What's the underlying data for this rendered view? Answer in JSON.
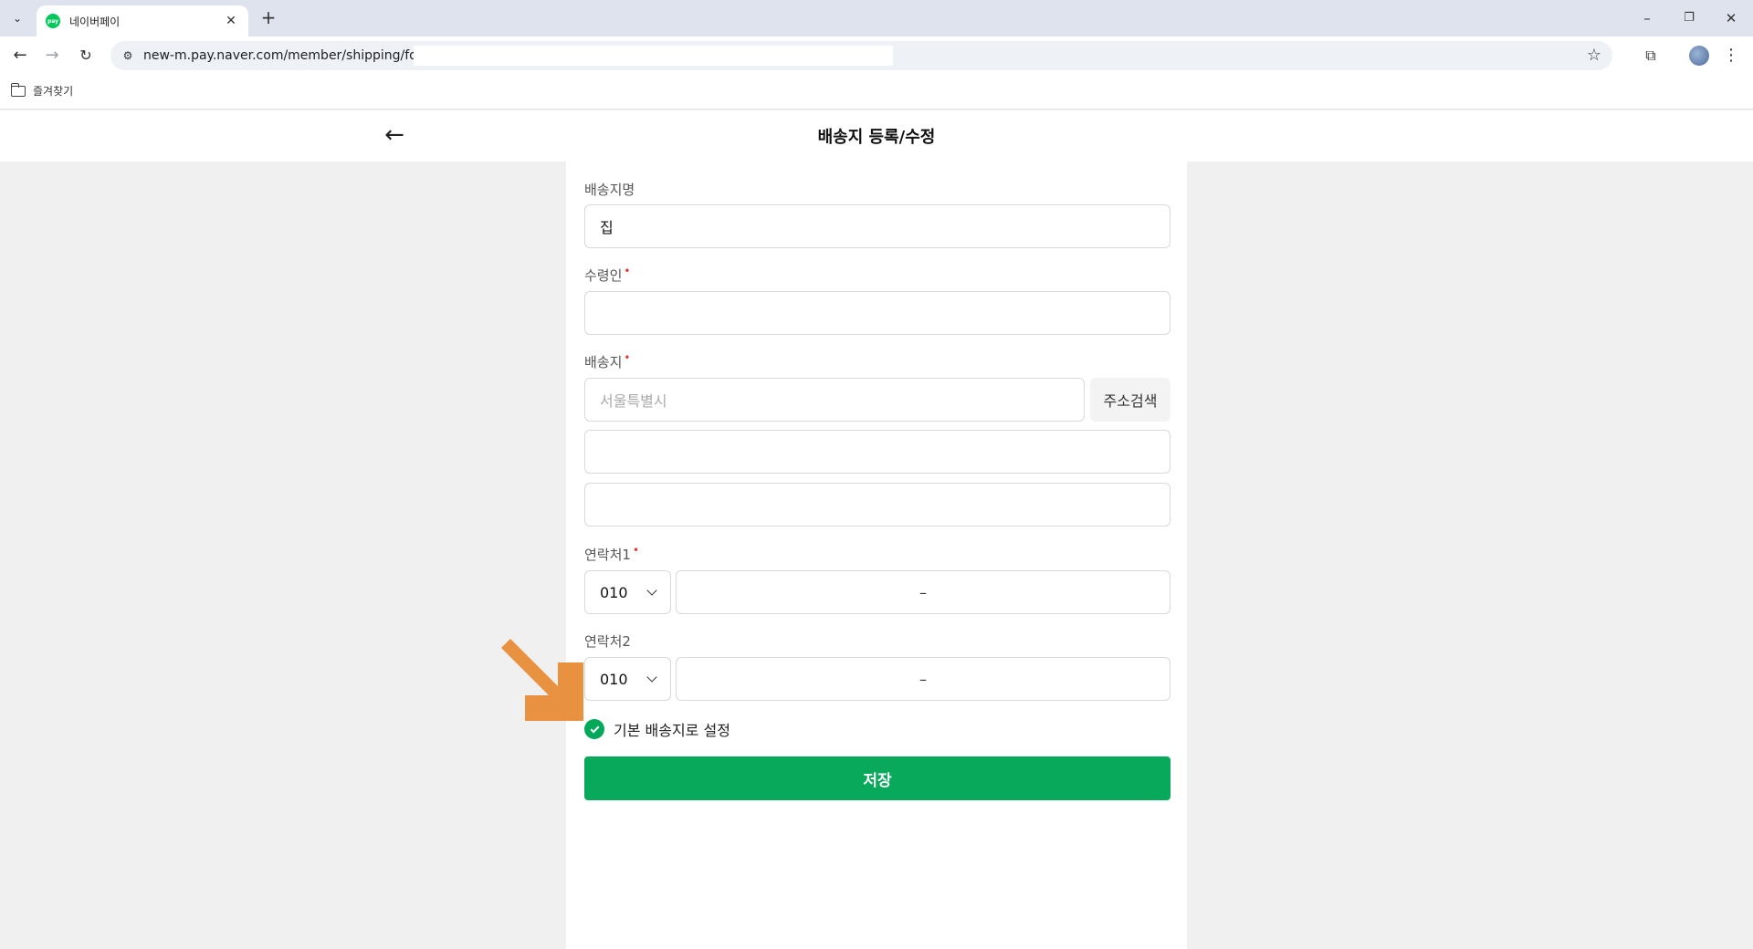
{
  "browser": {
    "tab_title": "네이버페이",
    "favicon_text": "pay",
    "url": "new-m.pay.naver.com/member/shipping/form?",
    "bookmark_folder": "즐겨찾기"
  },
  "header": {
    "title": "배송지 등록/수정"
  },
  "form": {
    "name_label": "배송지명",
    "name_value": "집",
    "recipient_label": "수령인",
    "recipient_value": "",
    "address_label": "배송지",
    "address_value": "서울특별시",
    "address_search_label": "주소검색",
    "address_detail1": "",
    "address_detail2": "",
    "contact1_label": "연락처1",
    "contact1_prefix": "010",
    "contact1_value": "–",
    "contact2_label": "연락처2",
    "contact2_prefix": "010",
    "contact2_value": "–",
    "default_label": "기본 배송지로 설정",
    "default_checked": true,
    "save_label": "저장",
    "required_mark": "•"
  },
  "colors": {
    "brand_green": "#08a95a",
    "required_red": "#e5372d",
    "annotation_arrow": "#e89140"
  }
}
